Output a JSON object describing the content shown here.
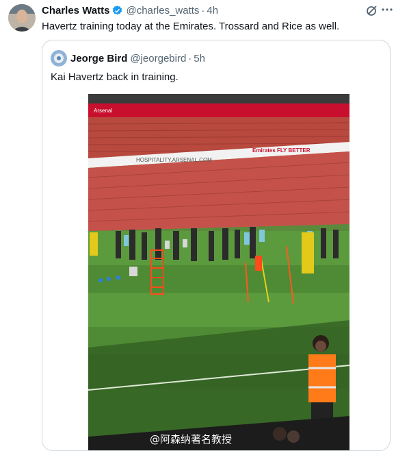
{
  "tweet": {
    "author_name": "Charles Watts",
    "author_handle": "@charles_watts",
    "separator": "·",
    "time": "4h",
    "text": "Havertz training today at the Emirates. Trossard and Rice as well.",
    "icons": [
      "verified-badge-icon",
      "grok-icon",
      "more-icon"
    ]
  },
  "quoted_tweet": {
    "author_name": "Jeorge Bird",
    "author_handle": "@jeorgebird",
    "separator": "·",
    "time": "5h",
    "text": "Kai Havertz back in training.",
    "image": {
      "banner_text_1": "Arsenal",
      "banner_text_2": "Emirates FLY BETTER",
      "banner_text_3": "HOSPITALITY.ARSENAL.COM",
      "watermark": "@阿森纳著名教授"
    }
  },
  "colors": {
    "accent": "#1d9bf0",
    "text_primary": "#0f1419",
    "text_secondary": "#536471",
    "border": "#cfd9de"
  }
}
